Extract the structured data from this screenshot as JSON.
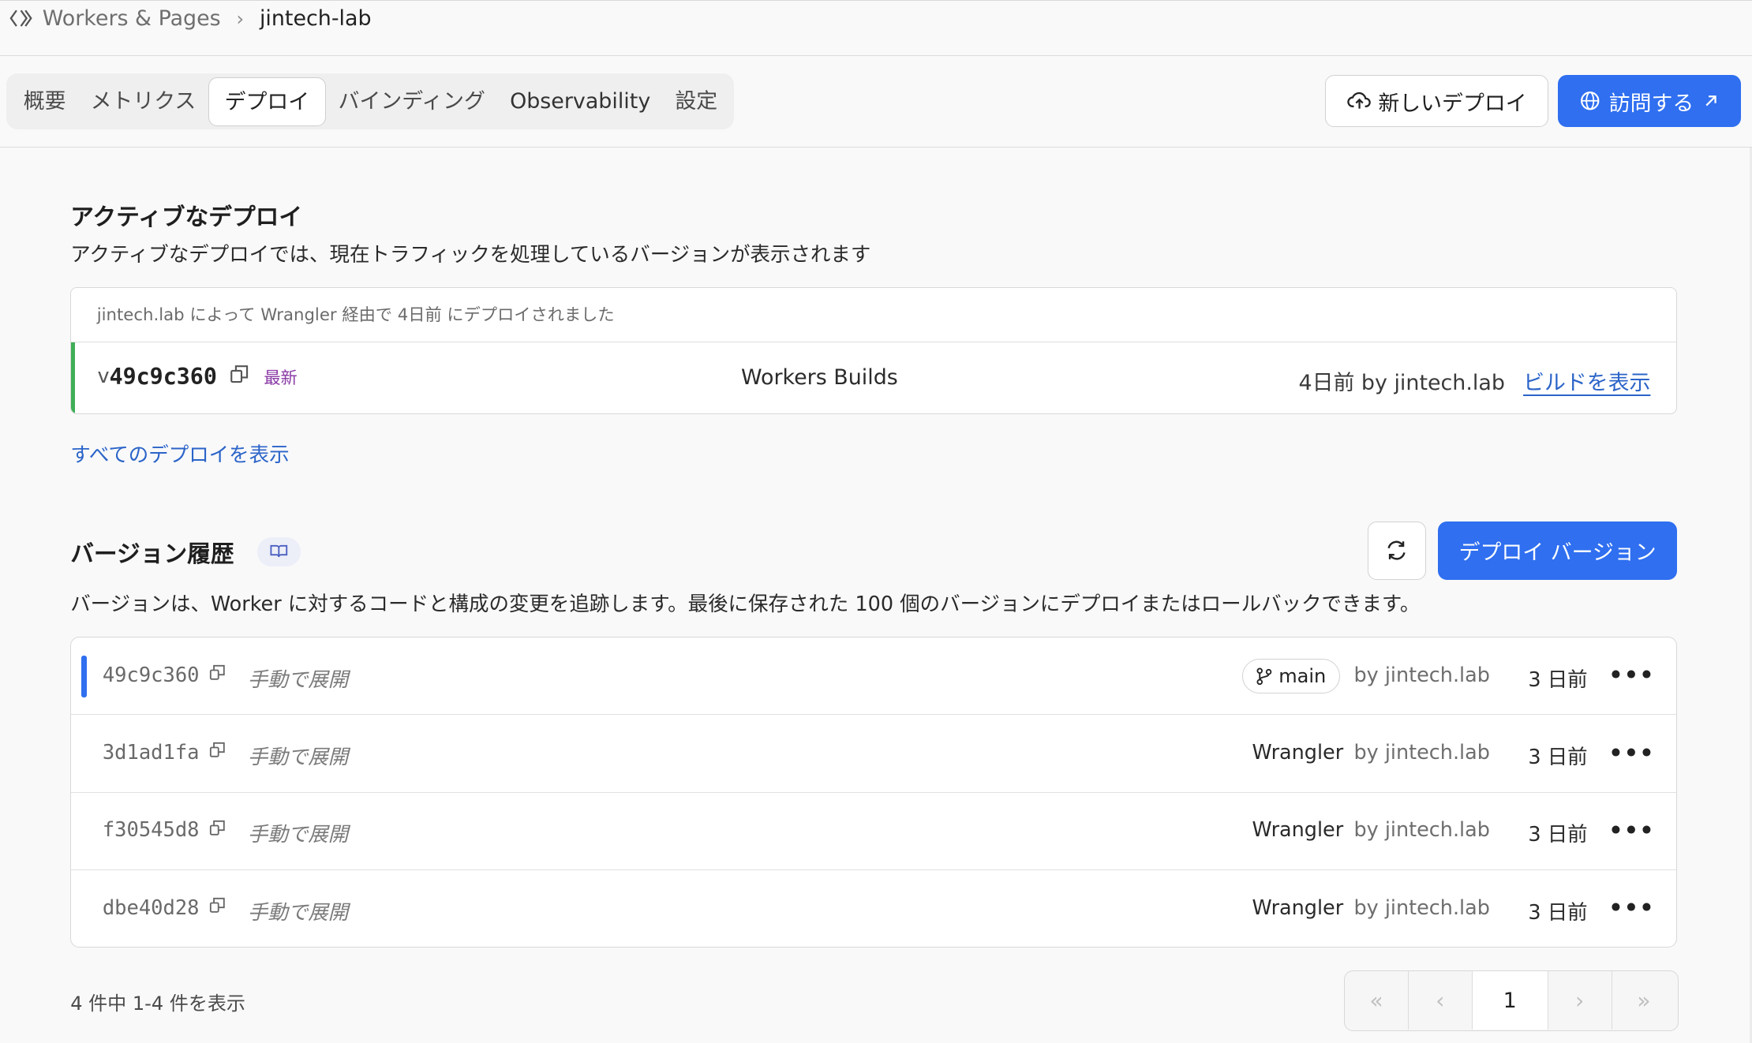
{
  "breadcrumb": {
    "parent": "Workers & Pages",
    "current": "jintech-lab"
  },
  "tabs": [
    {
      "label": "概要"
    },
    {
      "label": "メトリクス"
    },
    {
      "label": "デプロイ"
    },
    {
      "label": "バインディング"
    },
    {
      "label": "Observability"
    },
    {
      "label": "設定"
    }
  ],
  "actions": {
    "new_deploy": "新しいデプロイ",
    "visit": "訪問する"
  },
  "active": {
    "title": "アクティブなデプロイ",
    "description": "アクティブなデプロイでは、現在トラフィックを処理しているバージョンが表示されます",
    "header": "jintech.lab によって Wrangler 経由で 4日前 にデプロイされました",
    "version_prefix": "v",
    "version": "49c9c360",
    "latest": "最新",
    "source": "Workers Builds",
    "when": "4日前 by jintech.lab",
    "build_link": "ビルドを表示",
    "all_link": "すべてのデプロイを表示"
  },
  "history": {
    "title": "バージョン履歴",
    "deploy_version": "デプロイ バージョン",
    "description": "バージョンは、Worker に対するコードと構成の変更を追跡します。最後に保存された 100 個のバージョンにデプロイまたはロールバックできます。",
    "rows": [
      {
        "hash": "49c9c360",
        "method": "手動で展開",
        "source": "",
        "branch": "main",
        "by": "by jintech.lab",
        "ago": "3 日前"
      },
      {
        "hash": "3d1ad1fa",
        "method": "手動で展開",
        "source": "Wrangler",
        "branch": "",
        "by": "by jintech.lab",
        "ago": "3 日前"
      },
      {
        "hash": "f30545d8",
        "method": "手動で展開",
        "source": "Wrangler",
        "branch": "",
        "by": "by jintech.lab",
        "ago": "3 日前"
      },
      {
        "hash": "dbe40d28",
        "method": "手動で展開",
        "source": "Wrangler",
        "branch": "",
        "by": "by jintech.lab",
        "ago": "3 日前"
      }
    ],
    "more": "•••"
  },
  "pagination": {
    "summary": "4 件中 1-4 件を表示",
    "current_page": "1",
    "first": "«",
    "prev": "‹",
    "next": "›",
    "last": "»"
  },
  "colors": {
    "accent": "#2f6ff0",
    "active_green": "#3fae58",
    "latest_purple": "#8a3aa6",
    "link": "#2b64c8"
  }
}
